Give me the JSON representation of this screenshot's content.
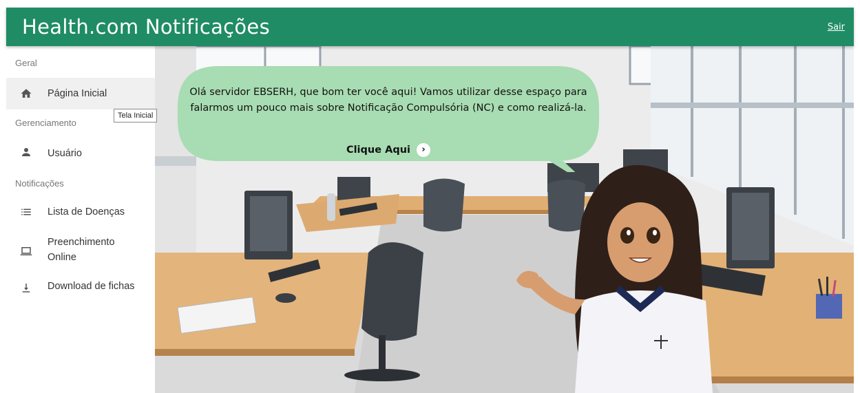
{
  "app": {
    "title": "Health.com Notificações",
    "logout_label": "Sair"
  },
  "sidebar": {
    "sections": [
      {
        "title": "Geral"
      },
      {
        "title": "Gerenciamento"
      },
      {
        "title": "Notificações"
      }
    ],
    "items": [
      {
        "label": "Página Inicial",
        "icon": "home-icon"
      },
      {
        "label": "Usuário",
        "icon": "user-icon"
      },
      {
        "label": "Lista de Doenças",
        "icon": "list-icon"
      },
      {
        "label": "Preenchimento Online",
        "icon": "laptop-icon"
      },
      {
        "label": "Download de fichas",
        "icon": "download-icon"
      }
    ],
    "tooltip": "Tela Inicial"
  },
  "welcome": {
    "message": "Olá servidor EBSERH, que bom ter você aqui! Vamos utilizar desse espaço para falarmos um pouco mais sobre Notificação Compulsória (NC) e como realizá-la.",
    "cta_label": "Clique Aqui"
  },
  "colors": {
    "primary": "#1f8c66",
    "bubble": "#a8dcb2"
  }
}
